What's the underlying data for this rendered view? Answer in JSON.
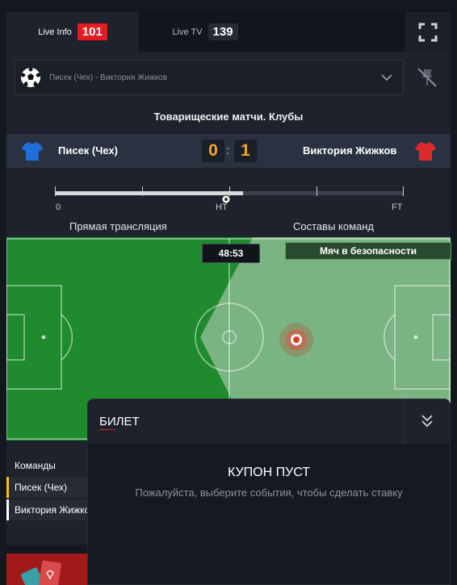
{
  "tabs": [
    {
      "label": "Live Info",
      "count": "101"
    },
    {
      "label": "Live TV",
      "count": "139"
    }
  ],
  "match_selector": {
    "value": "Писек (Чех) - Виктория Жижков"
  },
  "league": "Товарищеские матчи. Клубы",
  "score": {
    "home_team": "Писек (Чех)",
    "away_team": "Виктория Жижков",
    "home_score": "0",
    "away_score": "1",
    "separator": ":"
  },
  "timeline": {
    "start_label": "0",
    "half_label": "HT",
    "end_label": "FT",
    "progress": 0.54
  },
  "subtabs": {
    "live": "Прямая трансляция",
    "lineups": "Составы команд"
  },
  "field": {
    "timer": "48:53",
    "event": "Мяч в безопасности"
  },
  "teams": {
    "header": "Команды",
    "rows": [
      "Писек (Чех)",
      "Виктория Жижков"
    ]
  },
  "ticket": {
    "title": "БИЛЕТ",
    "empty_title": "КУПОН ПУСТ",
    "empty_text": "Пожалуйста, выберите события, чтобы сделать ставку"
  },
  "colors": {
    "accent": "#e31b23",
    "score": "#f5a623",
    "home_shirt": "#1e6fd9",
    "away_shirt": "#d92b2b"
  }
}
